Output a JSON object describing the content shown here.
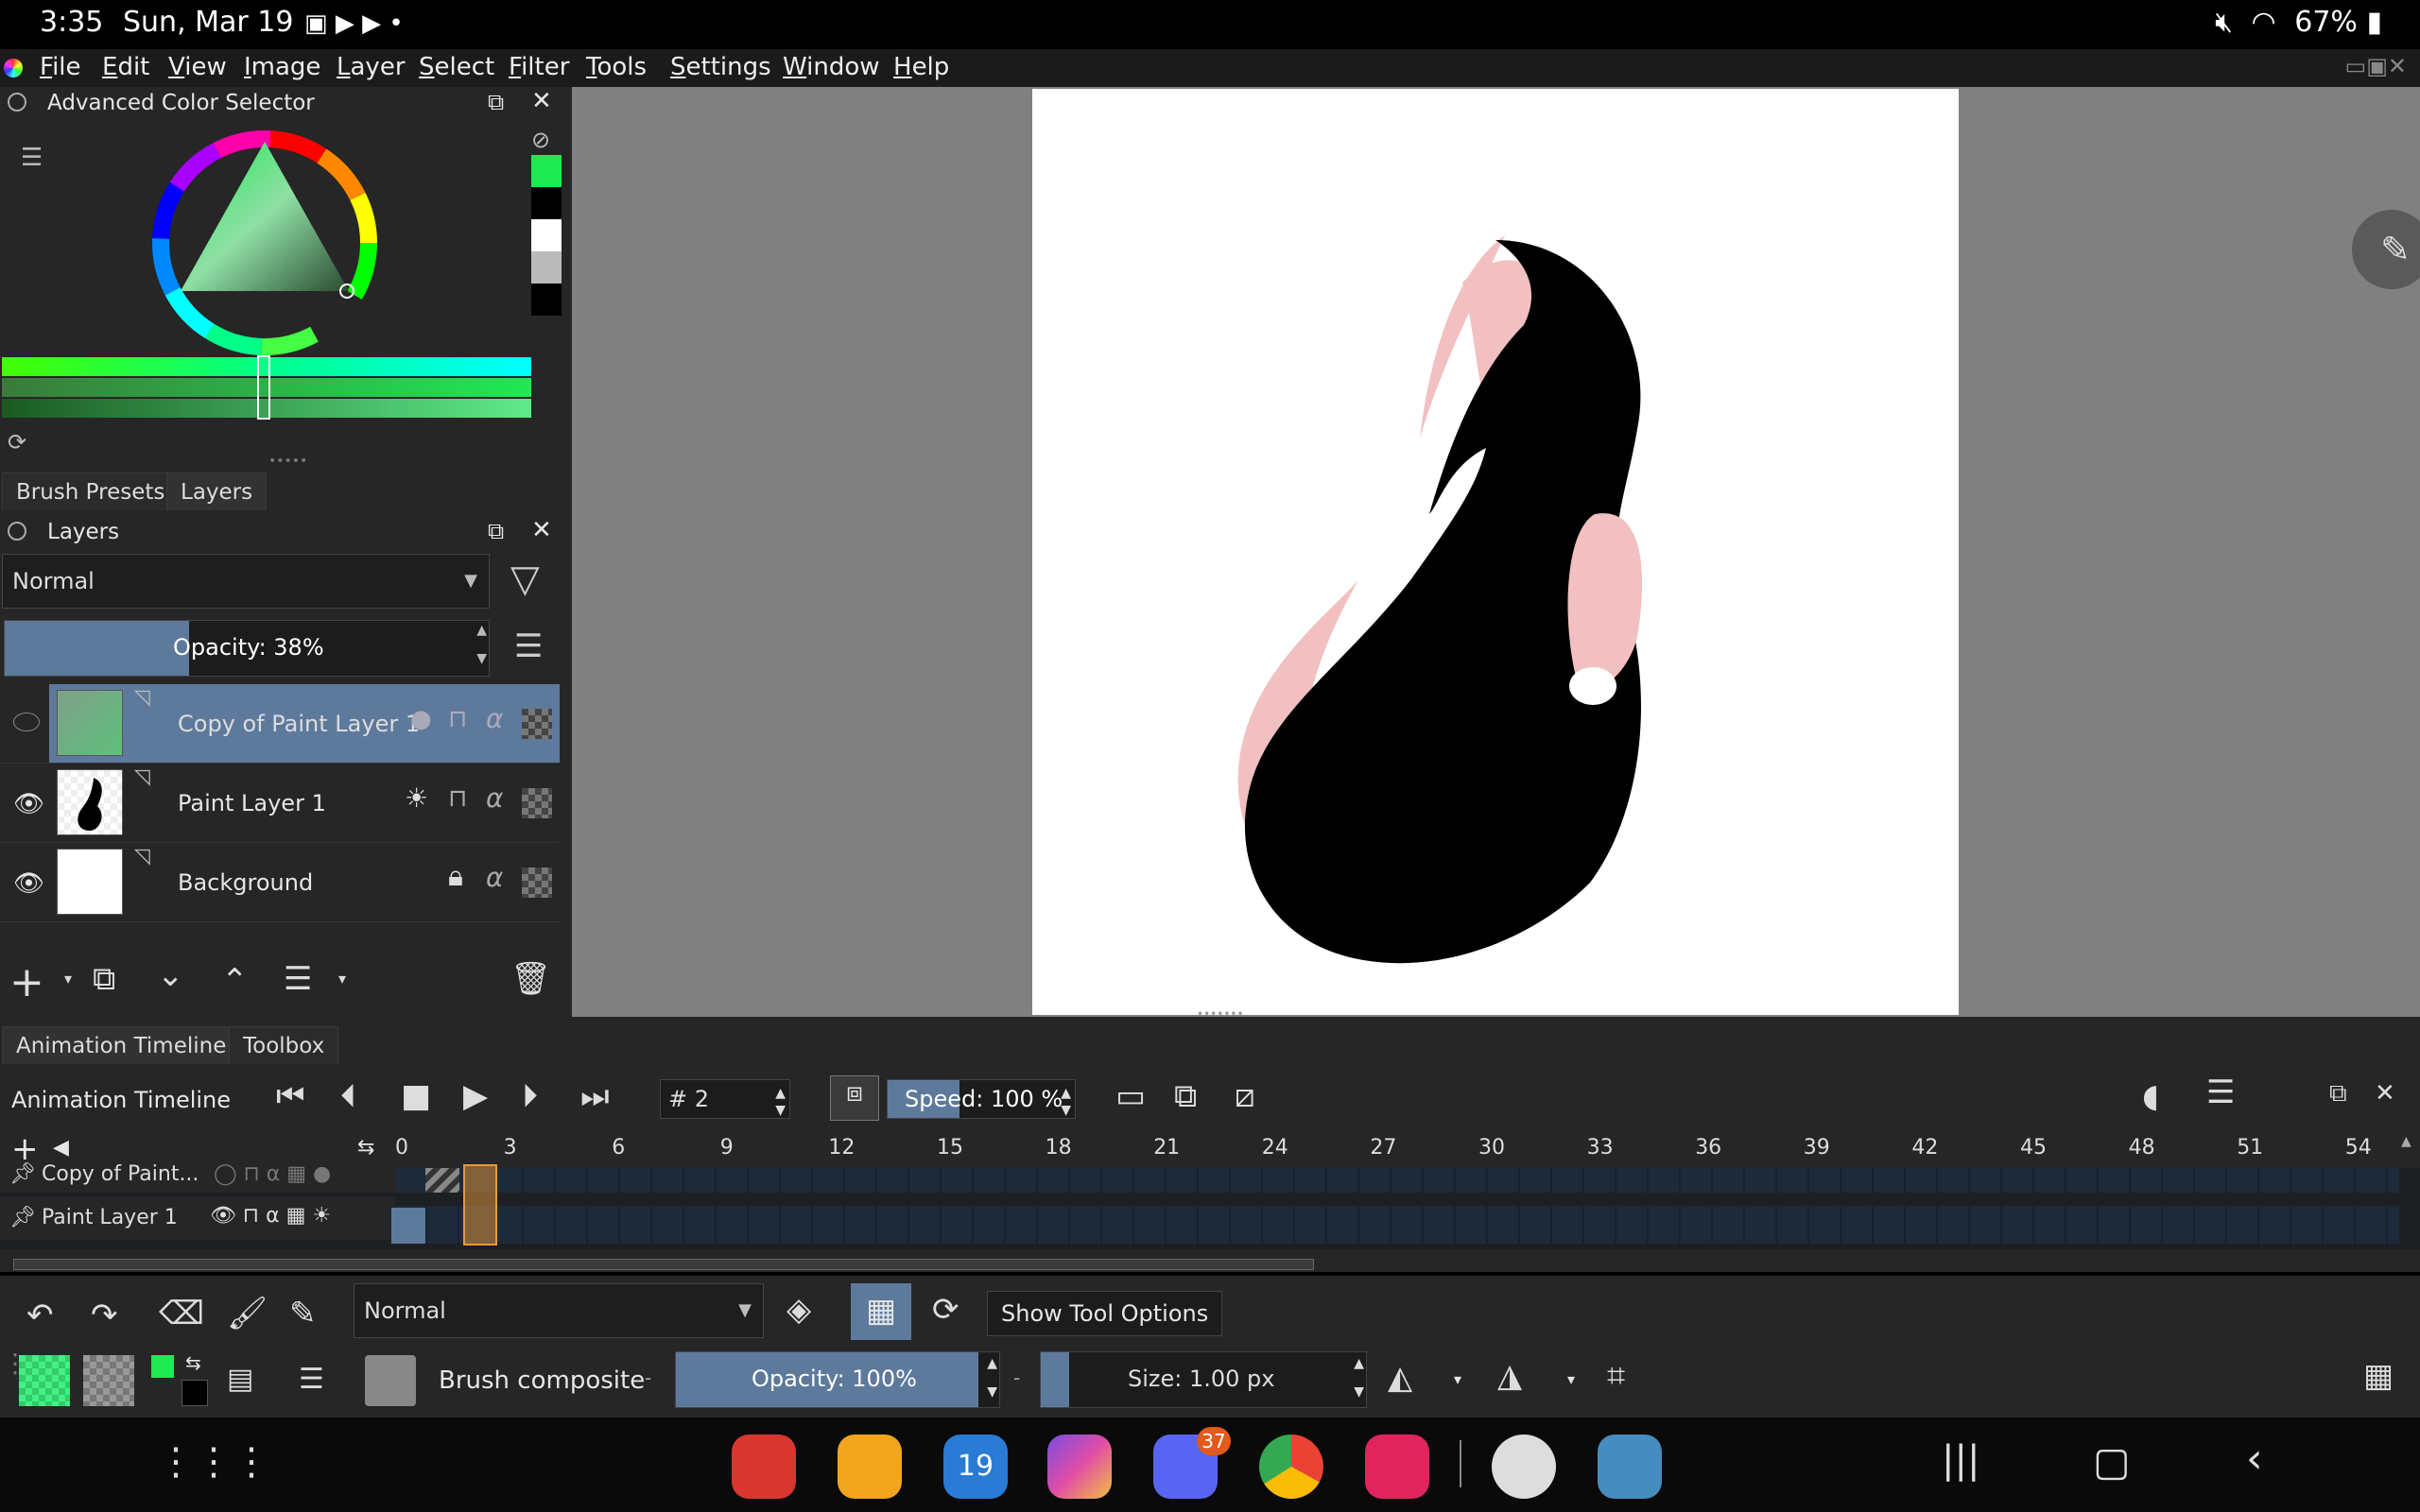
{
  "status_bar": {
    "time": "3:35",
    "date": "Sun, Mar 19",
    "battery": "67%"
  },
  "menu": [
    "File",
    "Edit",
    "View",
    "Image",
    "Layer",
    "Select",
    "Filter",
    "Tools",
    "Settings",
    "Window",
    "Help"
  ],
  "color_selector": {
    "title": "Advanced Color Selector",
    "foreground": "#1eea54"
  },
  "tabs_top": [
    "Brush Presets",
    "Layers"
  ],
  "layers_panel": {
    "title": "Layers",
    "blend_mode": "Normal",
    "opacity_label": "Opacity:  38%",
    "opacity_value": 38,
    "layers": [
      {
        "name": "Copy of Paint Layer 1",
        "selected": true,
        "visible": false
      },
      {
        "name": "Paint Layer 1",
        "selected": false,
        "visible": true
      },
      {
        "name": "Background",
        "selected": false,
        "visible": true
      }
    ]
  },
  "tabs_bottom": [
    "Animation Timeline",
    "Toolbox"
  ],
  "timeline": {
    "title": "Animation Timeline",
    "frame": "# 2",
    "speed": "Speed:  100 %",
    "ruler": [
      "0",
      "3",
      "6",
      "9",
      "12",
      "15",
      "18",
      "21",
      "24",
      "27",
      "30",
      "33",
      "36",
      "39",
      "42",
      "45",
      "48",
      "51",
      "54"
    ],
    "rows": [
      {
        "name": "Copy of Paint..."
      },
      {
        "name": "Paint Layer 1"
      }
    ]
  },
  "tool_options": {
    "blend_mode": "Normal",
    "show_tool_options": "Show Tool Options",
    "brush_preset": "Brush composite",
    "opacity": "Opacity:  100%",
    "size": "Size:  1.00 px"
  },
  "dock": {
    "discord_badge": "37",
    "calendar_day": "19"
  }
}
